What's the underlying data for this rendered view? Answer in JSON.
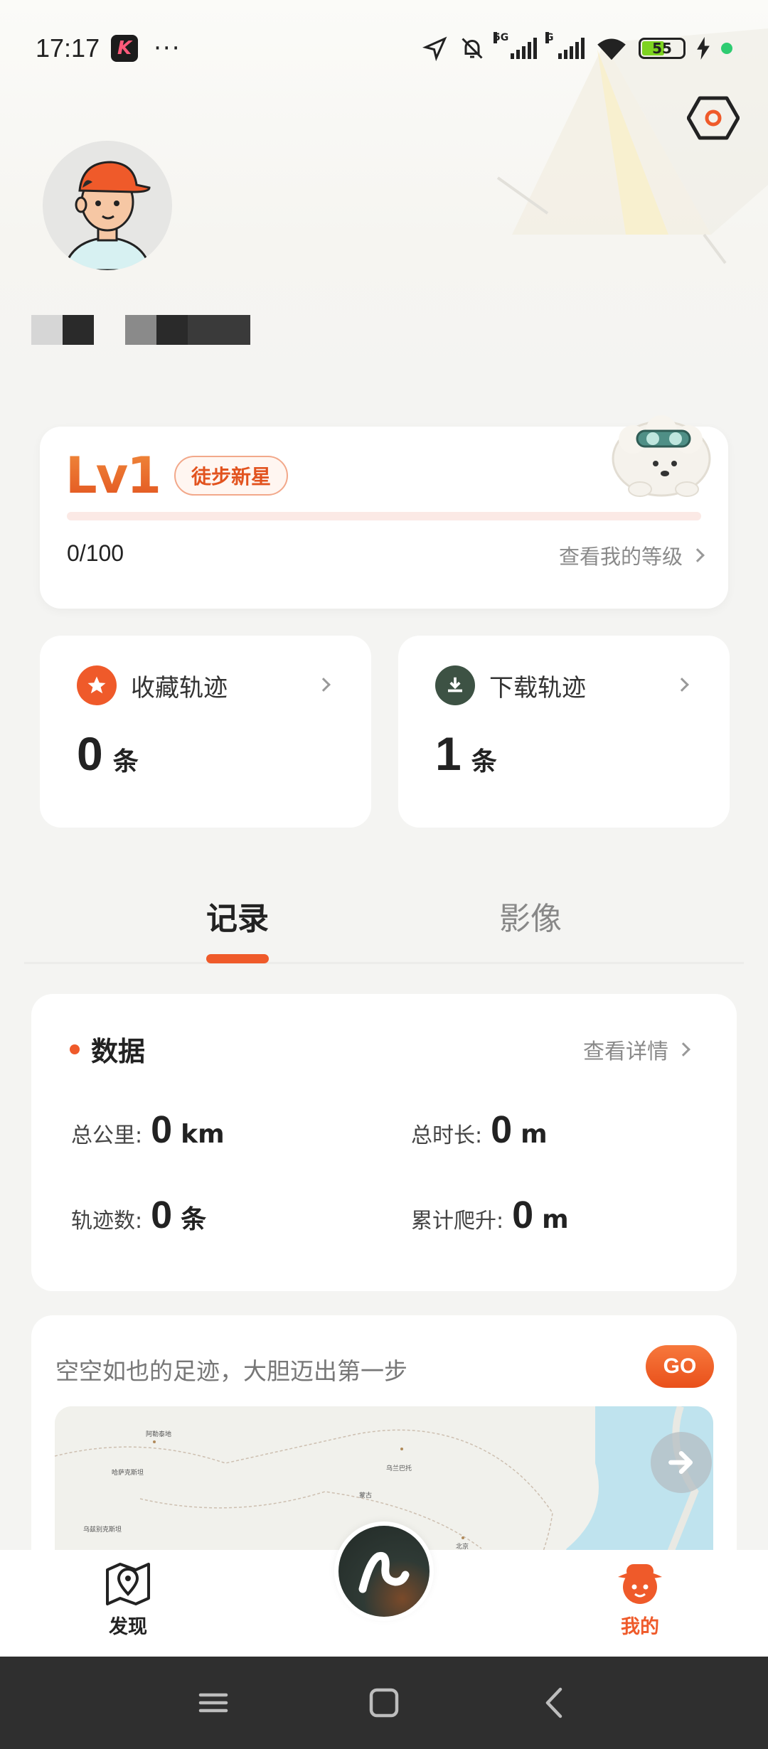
{
  "status_bar": {
    "time": "17:17",
    "app_badge": "K",
    "more": "···",
    "signal_1": "5G",
    "signal_2": "G",
    "battery": "55"
  },
  "profile": {
    "settings_icon": "hex-settings-icon",
    "avatar_icon": "cartoon-avatar-icon"
  },
  "level": {
    "label": "Lv1",
    "badge": "徒步新星",
    "progress_fraction": 0,
    "score": "0/100",
    "link": "查看我的等级"
  },
  "stats": [
    {
      "title": "收藏轨迹",
      "value": "0",
      "unit": "条",
      "icon": "star-icon",
      "color": "#ef5a2a"
    },
    {
      "title": "下载轨迹",
      "value": "1",
      "unit": "条",
      "icon": "download-icon",
      "color": "#3d5244"
    }
  ],
  "tabs": [
    {
      "label": "记录",
      "active": true
    },
    {
      "label": "影像",
      "active": false
    }
  ],
  "data_card": {
    "title": "数据",
    "link": "查看详情",
    "metrics": [
      {
        "label": "总公里:",
        "value": "0",
        "unit": "km"
      },
      {
        "label": "总时长:",
        "value": "0",
        "unit": "m"
      },
      {
        "label": "轨迹数:",
        "value": "0",
        "unit": "条"
      },
      {
        "label": "累计爬升:",
        "value": "0",
        "unit": "m"
      }
    ]
  },
  "map_card": {
    "prompt": "空空如也的足迹，大胆迈出第一步",
    "go_label": "GO",
    "labels": [
      "阿勒泰地",
      "哈萨克斯坦",
      "乌兰巴托",
      "蒙古",
      "乌兹别克斯坦",
      "北京"
    ]
  },
  "bottom_nav": {
    "discover": "发现",
    "mine": "我的",
    "active_color": "#ef5a2a"
  }
}
